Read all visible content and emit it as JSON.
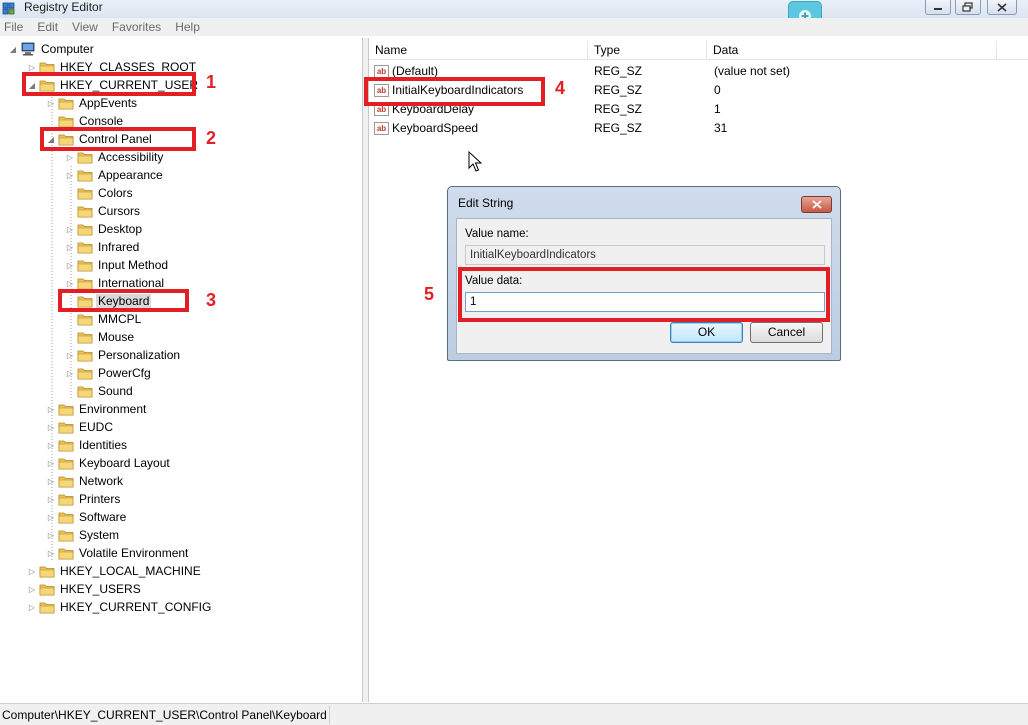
{
  "window": {
    "title": "Registry Editor"
  },
  "menu": [
    "File",
    "Edit",
    "View",
    "Favorites",
    "Help"
  ],
  "tree": {
    "root": "Computer",
    "hives": [
      "HKEY_CLASSES_ROOT",
      "HKEY_CURRENT_USER",
      "HKEY_LOCAL_MACHINE",
      "HKEY_USERS",
      "HKEY_CURRENT_CONFIG"
    ],
    "hkcu_children": [
      "AppEvents",
      "Console",
      "Control Panel",
      "Environment",
      "EUDC",
      "Identities",
      "Keyboard Layout",
      "Network",
      "Printers",
      "Software",
      "System",
      "Volatile Environment"
    ],
    "control_panel_children": [
      "Accessibility",
      "Appearance",
      "Colors",
      "Cursors",
      "Desktop",
      "Infrared",
      "Input Method",
      "International",
      "Keyboard",
      "MMCPL",
      "Mouse",
      "Personalization",
      "PowerCfg",
      "Sound"
    ],
    "selected": "Keyboard"
  },
  "list": {
    "columns": [
      "Name",
      "Type",
      "Data"
    ],
    "rows": [
      {
        "name": "(Default)",
        "type": "REG_SZ",
        "data": "(value not set)"
      },
      {
        "name": "InitialKeyboardIndicators",
        "type": "REG_SZ",
        "data": "0"
      },
      {
        "name": "KeyboardDelay",
        "type": "REG_SZ",
        "data": "1"
      },
      {
        "name": "KeyboardSpeed",
        "type": "REG_SZ",
        "data": "31"
      }
    ]
  },
  "status": {
    "path": "Computer\\HKEY_CURRENT_USER\\Control Panel\\Keyboard"
  },
  "dialog": {
    "title": "Edit String",
    "value_name_label": "Value name:",
    "value_name": "InitialKeyboardIndicators",
    "value_data_label": "Value data:",
    "value_data": "1",
    "ok_label": "OK",
    "cancel_label": "Cancel"
  },
  "annotations": [
    "1",
    "2",
    "3",
    "4",
    "5"
  ],
  "colors": {
    "annotation": "#e31e24",
    "folder": "#e8c35a"
  }
}
